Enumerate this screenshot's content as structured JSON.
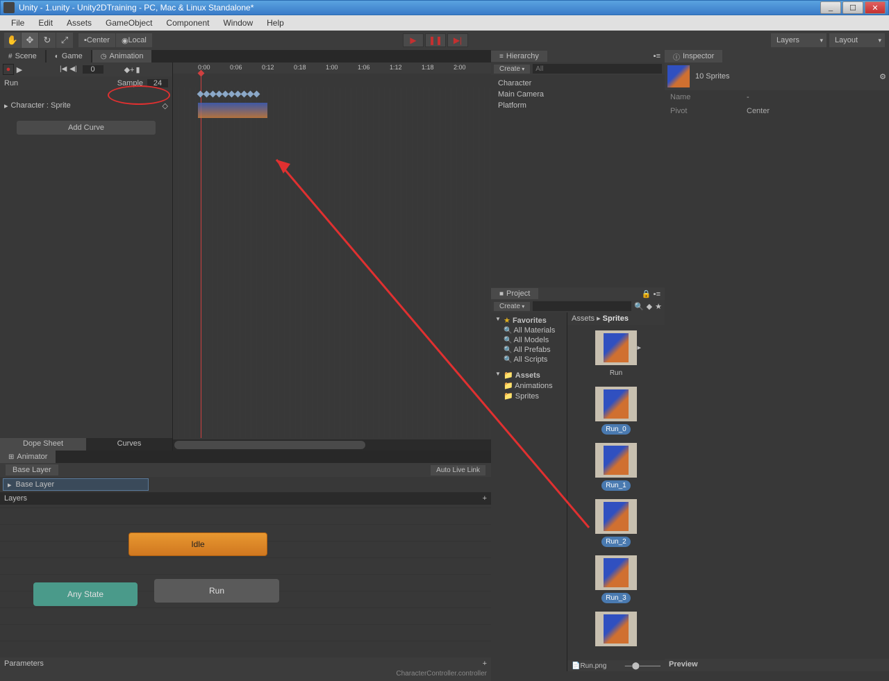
{
  "window": {
    "title": "Unity - 1.unity - Unity2DTraining - PC, Mac & Linux Standalone*"
  },
  "menu": [
    "File",
    "Edit",
    "Assets",
    "GameObject",
    "Component",
    "Window",
    "Help"
  ],
  "toolbar": {
    "center": "Center",
    "local": "Local",
    "layers": "Layers",
    "layout": "Layout"
  },
  "tabs": {
    "scene": "Scene",
    "game": "Game",
    "animation": "Animation",
    "hierarchy": "Hierarchy",
    "project": "Project",
    "inspector": "Inspector",
    "animator": "Animator"
  },
  "animation": {
    "frame": "0",
    "clip": "Run",
    "sample_label": "Sample",
    "sample_value": "24",
    "property": "Character : Sprite",
    "add_curve": "Add Curve",
    "ruler": [
      "0:00",
      "0:06",
      "0:12",
      "0:18",
      "1:00",
      "1:06",
      "1:12",
      "1:18",
      "2:00"
    ],
    "dope_sheet": "Dope Sheet",
    "curves": "Curves"
  },
  "animator": {
    "base_layer_crumb": "Base Layer",
    "auto_live": "Auto Live Link",
    "layer": "Base Layer",
    "layers_label": "Layers",
    "idle": "Idle",
    "any_state": "Any State",
    "run": "Run",
    "parameters": "Parameters",
    "footer": "CharacterController.controller"
  },
  "hierarchy": {
    "create": "Create",
    "search_ph": "All",
    "items": [
      "Character",
      "Main Camera",
      "Platform"
    ]
  },
  "project": {
    "create": "Create",
    "favorites": "Favorites",
    "fav_items": [
      "All Materials",
      "All Models",
      "All Prefabs",
      "All Scripts"
    ],
    "assets": "Assets",
    "assets_items": [
      "Animations",
      "Sprites"
    ],
    "crumb_assets": "Assets",
    "crumb_sprites": "Sprites",
    "run_folder": "Run",
    "sprites": [
      "Run_0",
      "Run_1",
      "Run_2",
      "Run_3"
    ],
    "footer": "Run.png"
  },
  "inspector": {
    "title": "10 Sprites",
    "name_label": "Name",
    "name_val": "-",
    "pivot_label": "Pivot",
    "pivot_val": "Center",
    "preview": "Preview"
  }
}
